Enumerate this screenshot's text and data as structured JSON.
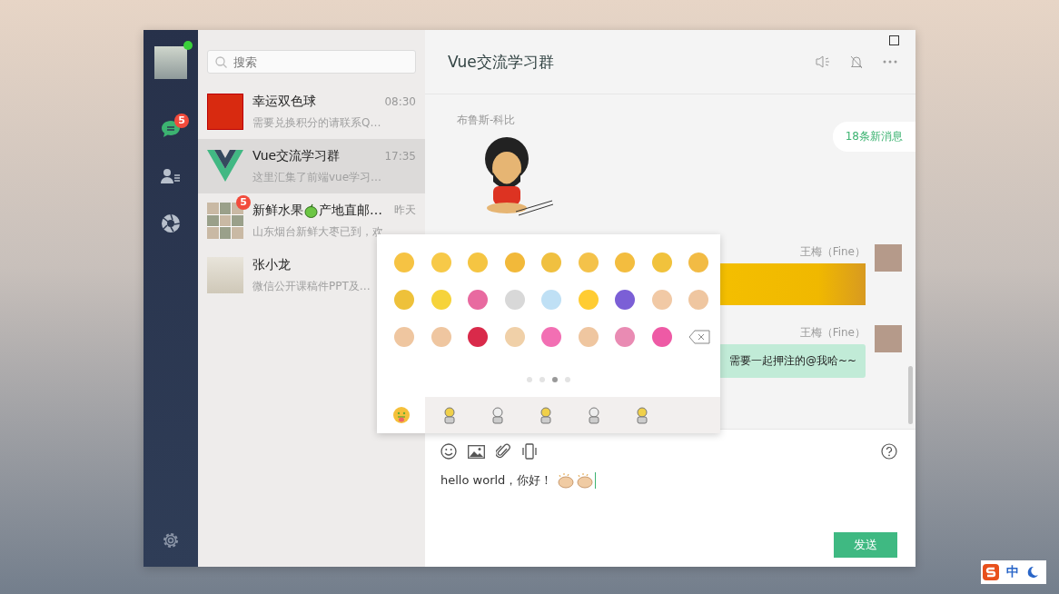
{
  "sidebar": {
    "online": true,
    "nav": [
      {
        "kind": "chat",
        "selected": true,
        "badge": "5"
      },
      {
        "kind": "contacts",
        "selected": false
      },
      {
        "kind": "moments",
        "selected": false
      }
    ]
  },
  "search": {
    "placeholder": "搜索"
  },
  "conversations": [
    {
      "kind": "poster",
      "name": "幸运双色球",
      "time": "08:30",
      "preview": "需要兑换积分的请联系Q…",
      "selected": false
    },
    {
      "kind": "vue",
      "name": "Vue交流学习群",
      "time": "17:35",
      "preview": "这里汇集了前端vue学习…",
      "selected": true
    },
    {
      "kind": "group",
      "name": "新鲜水果",
      "name_after_icon": "产地直邮…",
      "time": "昨天",
      "preview": "山东烟台新鲜大枣已到，欢",
      "badge": "5",
      "selected": false
    },
    {
      "kind": "photo",
      "name": "张小龙",
      "preview": "微信公开课稿件PPT及…",
      "selected": false
    }
  ],
  "chat": {
    "title": "Vue交流学习群",
    "new_messages": "18条新消息",
    "messages": [
      {
        "kind": "sticker",
        "outgoing": false,
        "sender": "布鲁斯-科比"
      },
      {
        "kind": "image",
        "outgoing": true,
        "sender": "王梅（Fine）"
      },
      {
        "kind": "text",
        "outgoing": true,
        "sender": "王梅（Fine）",
        "text": "需要一起押注的@我哈~~"
      }
    ]
  },
  "emoji_panel": {
    "pages": [
      {
        "selected": false
      },
      {
        "selected": false
      },
      {
        "selected": true
      },
      {
        "selected": false
      }
    ],
    "tabs": [
      {
        "kind": "emoji",
        "selected": true
      },
      {
        "kind": "sticker",
        "selected": false
      },
      {
        "kind": "sticker",
        "selected": false
      },
      {
        "kind": "sticker",
        "selected": false
      },
      {
        "kind": "sticker",
        "selected": false
      },
      {
        "kind": "sticker",
        "selected": false
      }
    ]
  },
  "composer": {
    "value": "hello world，你好！",
    "send": "发送"
  },
  "ime": {
    "label": "中"
  }
}
